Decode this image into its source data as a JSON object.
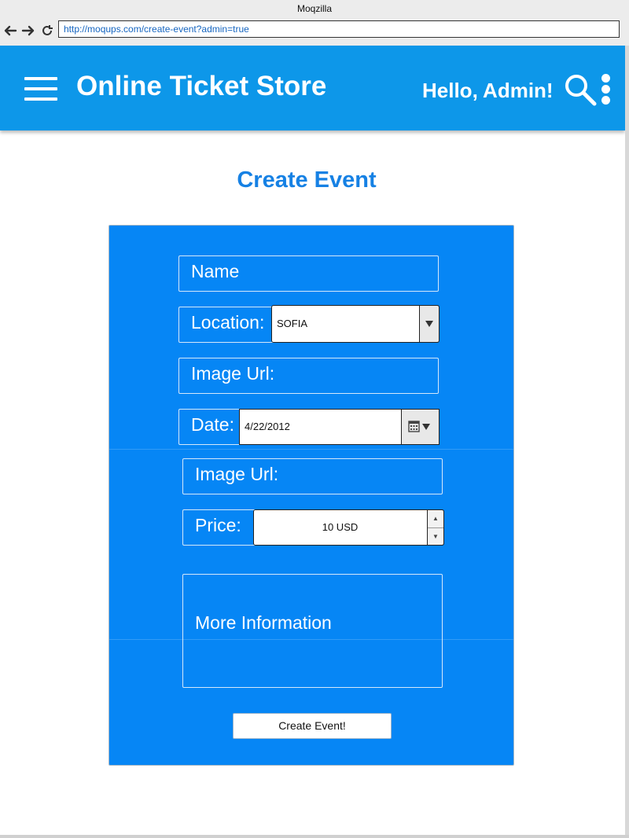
{
  "browser": {
    "window_title": "Moqzilla",
    "url": "http://moqups.com/create-event?admin=true"
  },
  "header": {
    "title": "Online Ticket Store",
    "greeting": "Hello, Admin!",
    "icons": [
      "menu-icon",
      "search-icon",
      "more-vertical-icon"
    ],
    "color": "#0d97e9"
  },
  "page": {
    "title": "Create Event"
  },
  "form": {
    "panel_color": "#0686f5",
    "name_label": "Name",
    "location_label": "Location:",
    "location_value": "SOFIA",
    "image_url_label": "Image Url:",
    "date_label": "Date:",
    "date_value": "4/22/2012",
    "image_url_label_2": "Image Url:",
    "price_label": "Price:",
    "price_value": "10 USD",
    "more_info_label": "More Information",
    "submit_label": "Create Event!"
  }
}
